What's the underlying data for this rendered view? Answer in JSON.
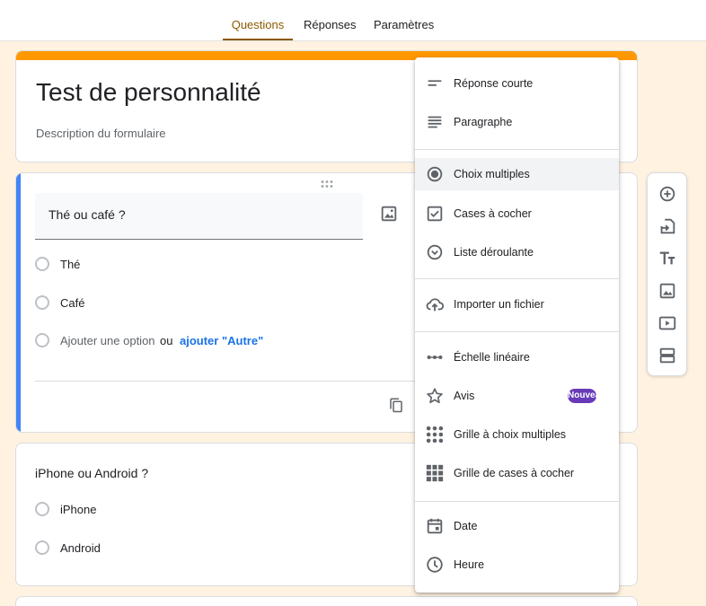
{
  "tabs": [
    {
      "label": "Questions",
      "active": true
    },
    {
      "label": "Réponses",
      "active": false
    },
    {
      "label": "Paramètres",
      "active": false
    }
  ],
  "form": {
    "title": "Test de personnalité",
    "description": "Description du formulaire",
    "accent_color": "#ff9800"
  },
  "question1": {
    "title": "Thé ou café ?",
    "options": [
      "Thé",
      "Café"
    ],
    "add_option": "Ajouter une option",
    "or_text": "ou",
    "add_other": "ajouter \"Autre\"",
    "selected_color": "#4285f4"
  },
  "question2": {
    "title": "iPhone ou Android ?",
    "options": [
      "iPhone",
      "Android"
    ]
  },
  "side_toolbar": [
    "add-question-icon",
    "import-questions-icon",
    "add-title-icon",
    "add-image-icon",
    "add-video-icon",
    "add-section-icon"
  ],
  "type_menu": {
    "items": [
      {
        "label": "Réponse courte",
        "icon": "short-answer-icon"
      },
      {
        "label": "Paragraphe",
        "icon": "paragraph-icon"
      },
      {
        "label": "Choix multiples",
        "icon": "radio-button-icon",
        "highlighted": true
      },
      {
        "label": "Cases à cocher",
        "icon": "checkbox-icon"
      },
      {
        "label": "Liste déroulante",
        "icon": "dropdown-icon"
      },
      {
        "label": "Importer un fichier",
        "icon": "cloud-upload-icon"
      },
      {
        "label": "Échelle linéaire",
        "icon": "linear-scale-icon"
      },
      {
        "label": "Avis",
        "icon": "star-icon",
        "badge": "Nouveau"
      },
      {
        "label": "Grille à choix multiples",
        "icon": "dots-grid-icon"
      },
      {
        "label": "Grille de cases à cocher",
        "icon": "checkbox-grid-icon"
      },
      {
        "label": "Date",
        "icon": "calendar-icon"
      },
      {
        "label": "Heure",
        "icon": "clock-icon"
      }
    ],
    "badge_color": "#673ab7"
  }
}
